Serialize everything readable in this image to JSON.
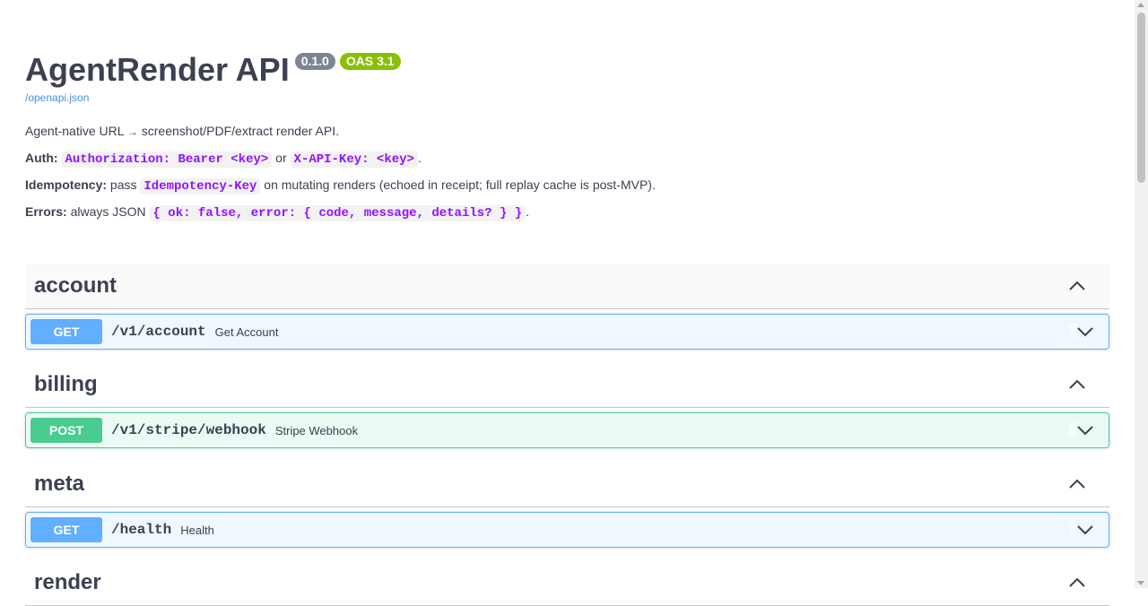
{
  "info": {
    "title": "AgentRender API",
    "version": "0.1.0",
    "oas": "OAS 3.1",
    "spec_link": "/openapi.json",
    "description": "Agent-native URL",
    "description_arrow": "→",
    "description_rest": "screenshot/PDF/extract render API.",
    "auth_label": "Auth:",
    "auth_code1": "Authorization: Bearer <key>",
    "auth_or": "or",
    "auth_code2": "X-API-Key: <key>",
    "auth_end": ".",
    "idem_label": "Idempotency:",
    "idem_pre": "pass",
    "idem_code": "Idempotency-Key",
    "idem_post": "on mutating renders (echoed in receipt; full replay cache is post-MVP).",
    "err_label": "Errors:",
    "err_pre": "always JSON",
    "err_code": "{ ok: false, error: { code, message, details? } }",
    "err_end": "."
  },
  "tags": [
    {
      "name": "account",
      "op": {
        "method": "GET",
        "path": "/v1/account",
        "summary": "Get Account"
      }
    },
    {
      "name": "billing",
      "op": {
        "method": "POST",
        "path": "/v1/stripe/webhook",
        "summary": "Stripe Webhook"
      }
    },
    {
      "name": "meta",
      "op": {
        "method": "GET",
        "path": "/health",
        "summary": "Health"
      }
    },
    {
      "name": "render"
    }
  ],
  "colors": {
    "get": "#61affe",
    "post": "#49cc90",
    "code": "#9012fe",
    "link": "#4990e2"
  }
}
